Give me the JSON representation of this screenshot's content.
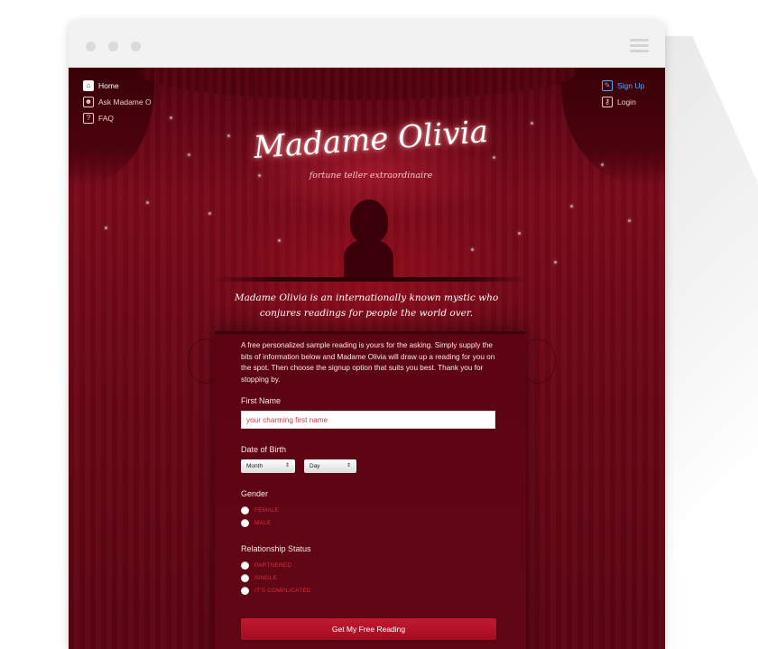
{
  "nav_left": [
    {
      "label": "Home",
      "icon": "home-icon",
      "glyph": "⌂"
    },
    {
      "label": "Ask Madame O",
      "icon": "person-icon",
      "glyph": "☻"
    },
    {
      "label": "FAQ",
      "icon": "question-icon",
      "glyph": "?"
    }
  ],
  "nav_right": [
    {
      "label": "Sign Up",
      "icon": "wand-icon",
      "glyph": "✎"
    },
    {
      "label": "Login",
      "icon": "key-icon",
      "glyph": "⚷"
    }
  ],
  "logo": {
    "title": "Madame Olivia",
    "subtitle": "fortune teller extraordinaire"
  },
  "tagline": "Madame Olivia is an internationally known mystic who conjures readings for people the world over.",
  "intro": "A free personalized sample reading is yours for the asking. Simply supply the bits of information below and Madame Olivia will draw up a reading for you on the spot. Then choose the signup option that suits you best. Thank you for stopping by.",
  "form": {
    "first_name_label": "First Name",
    "first_name_placeholder": "your charming first name",
    "dob_label": "Date of Birth",
    "month_select": "Month",
    "day_select": "Day",
    "gender_label": "Gender",
    "gender_options": [
      "FEMALE",
      "MALE"
    ],
    "relationship_label": "Relationship Status",
    "relationship_options": [
      "PARTNERED",
      "SINGLE",
      "IT'S COMPLICATED"
    ],
    "submit": "Get My Free Reading"
  },
  "colors": {
    "background": "#6a0716",
    "accent": "#c21a30",
    "link": "#58aaff"
  }
}
